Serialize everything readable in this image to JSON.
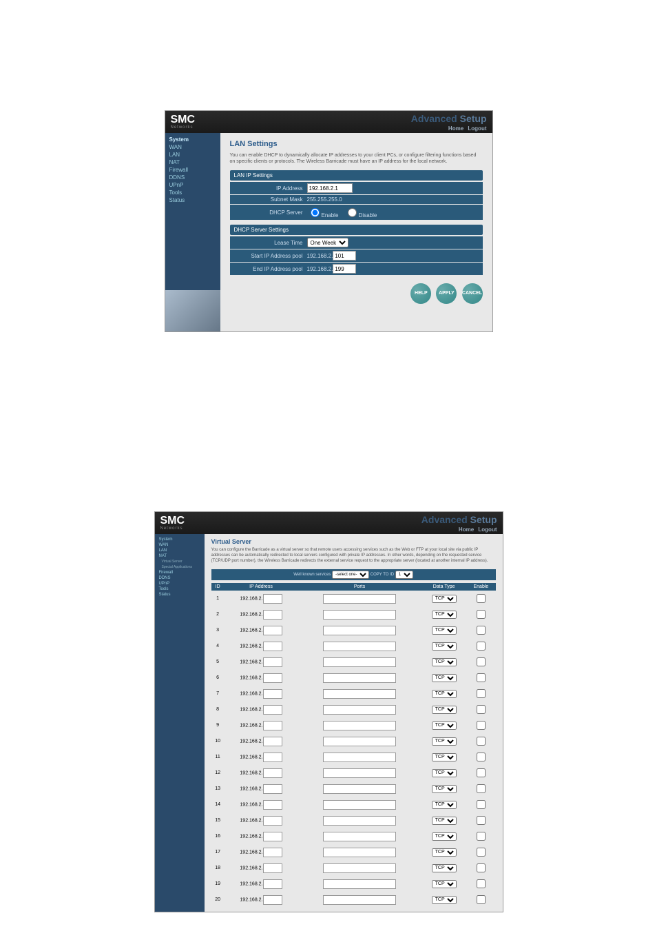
{
  "brand": "SMC",
  "brand_sub": "Networks",
  "header_title_1": "Advanced",
  "header_title_2": "Setup",
  "header_tabs": {
    "home": "Home",
    "logout": "Logout"
  },
  "nav1": {
    "items": [
      "System",
      "WAN",
      "LAN",
      "NAT",
      "Firewall",
      "DDNS",
      "UPnP",
      "Tools",
      "Status"
    ]
  },
  "lan": {
    "title": "LAN Settings",
    "desc": "You can enable DHCP to dynamically allocate IP addresses to your client PCs, or configure filtering functions based on specific clients or protocols. The Wireless Barricade must have an IP address for the local network.",
    "panel1": "LAN IP Settings",
    "ip_label": "IP Address",
    "ip_value": "192.168.2.1",
    "mask_label": "Subnet Mask",
    "mask_value": "255.255.255.0",
    "dhcp_label": "DHCP Server",
    "dhcp_enable": "Enable",
    "dhcp_disable": "Disable",
    "panel2": "DHCP Server Settings",
    "lease_label": "Lease Time",
    "lease_value": "One Week",
    "start_label": "Start IP Address pool",
    "start_prefix": "192.168.2.",
    "start_value": "101",
    "end_label": "End IP Address pool",
    "end_prefix": "192.168.2.",
    "end_value": "199",
    "btn_help": "HELP",
    "btn_apply": "APPLY",
    "btn_cancel": "CANCEL"
  },
  "nav2": {
    "items": [
      "System",
      "WAN",
      "LAN",
      "NAT"
    ],
    "nat_sub": [
      "Virtual Server",
      "Special Applications"
    ],
    "items2": [
      "Firewall",
      "DDNS",
      "UPnP",
      "Tools",
      "Status"
    ]
  },
  "vs": {
    "title": "Virtual Server",
    "desc": "You can configure the Barricade as a virtual server so that remote users accessing services such as the Web or FTP at your local site via public IP addresses can be automatically redirected to local servers configured with private IP addresses. In other words, depending on the requested service (TCP/UDP port number), the Wireless Barricade redirects the external service request to the appropriate server (located at another internal IP address).",
    "wellknown_label": "Well known services",
    "wellknown_sel": "-select one-",
    "copyto_label": "COPY TO",
    "copyto_id": "ID",
    "id_sel": "1",
    "th_id": "ID",
    "th_ip": "IP Address",
    "th_ports": "Ports",
    "th_type": "Data Type",
    "th_enable": "Enable",
    "ip_prefix": "192.168.2.",
    "type_option": "TCP",
    "rows": 20
  }
}
